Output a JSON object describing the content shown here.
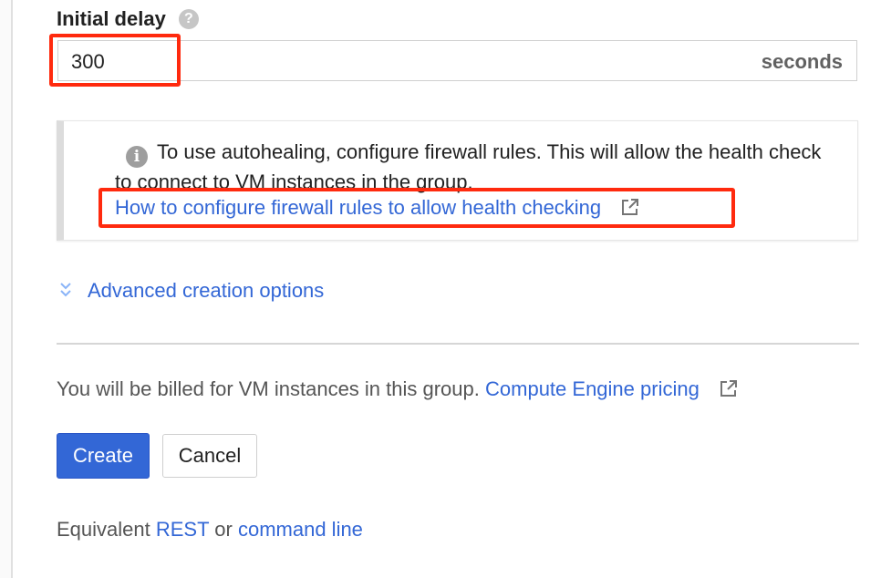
{
  "initial_delay": {
    "label": "Initial delay",
    "help_icon": "help-circle-icon",
    "value": "300",
    "suffix": "seconds"
  },
  "info_box": {
    "icon": "info-icon",
    "message": "To use autohealing, configure firewall rules. This will allow the health check to connect to VM instances in the group.",
    "link_label": "How to configure firewall rules to allow health checking",
    "link_icon": "external-link-icon"
  },
  "advanced": {
    "icon": "double-chevron-down-icon",
    "label": "Advanced creation options"
  },
  "billing": {
    "text": "You will be billed for VM instances in this group.",
    "link_label": "Compute Engine pricing",
    "link_icon": "external-link-icon"
  },
  "actions": {
    "create_label": "Create",
    "cancel_label": "Cancel"
  },
  "equivalent": {
    "prefix": "Equivalent",
    "rest_label": "REST",
    "or": "or",
    "cli_label": "command line"
  },
  "colors": {
    "accent": "#3367d6",
    "highlight": "#ff2a0e"
  }
}
